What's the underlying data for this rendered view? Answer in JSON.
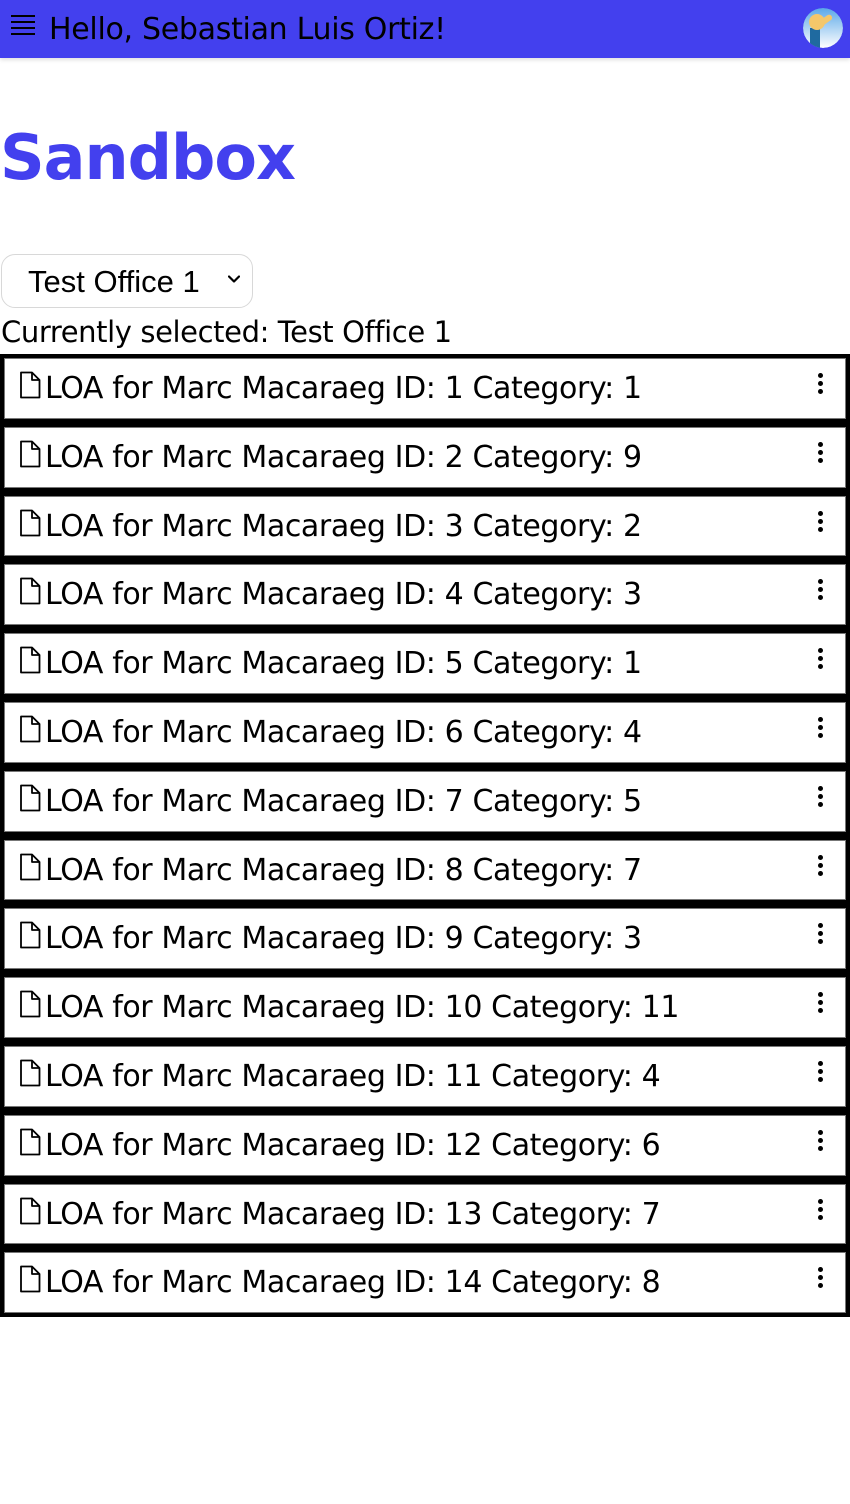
{
  "header": {
    "greeting": "Hello, Sebastian Luis Ortiz!",
    "menu_icon": "hamburger-menu-icon",
    "avatar_icon": "user-avatar",
    "brand_color": "#4340ee"
  },
  "page": {
    "title": "Sandbox"
  },
  "office_select": {
    "selected": "Test Office 1",
    "chevron_icon": "chevron-down-icon"
  },
  "current_selection_text": "Currently selected: Test Office 1",
  "documents": [
    {
      "label": "LOA for Marc Macaraeg ID: 1 Category: 1",
      "id": 1,
      "category": 1
    },
    {
      "label": "LOA for Marc Macaraeg ID: 2 Category: 9",
      "id": 2,
      "category": 9
    },
    {
      "label": "LOA for Marc Macaraeg ID: 3 Category: 2",
      "id": 3,
      "category": 2
    },
    {
      "label": "LOA for Marc Macaraeg ID: 4 Category: 3",
      "id": 4,
      "category": 3
    },
    {
      "label": "LOA for Marc Macaraeg ID: 5 Category: 1",
      "id": 5,
      "category": 1
    },
    {
      "label": "LOA for Marc Macaraeg ID: 6 Category: 4",
      "id": 6,
      "category": 4
    },
    {
      "label": "LOA for Marc Macaraeg ID: 7 Category: 5",
      "id": 7,
      "category": 5
    },
    {
      "label": "LOA for Marc Macaraeg ID: 8 Category: 7",
      "id": 8,
      "category": 7
    },
    {
      "label": "LOA for Marc Macaraeg ID: 9 Category: 3",
      "id": 9,
      "category": 3
    },
    {
      "label": "LOA for Marc Macaraeg ID: 10 Category: 11",
      "id": 10,
      "category": 11
    },
    {
      "label": "LOA for Marc Macaraeg ID: 11 Category: 4",
      "id": 11,
      "category": 4
    },
    {
      "label": "LOA for Marc Macaraeg ID: 12 Category: 6",
      "id": 12,
      "category": 6
    },
    {
      "label": "LOA for Marc Macaraeg ID: 13 Category: 7",
      "id": 13,
      "category": 7
    },
    {
      "label": "LOA for Marc Macaraeg ID: 14 Category: 8",
      "id": 14,
      "category": 8
    }
  ]
}
